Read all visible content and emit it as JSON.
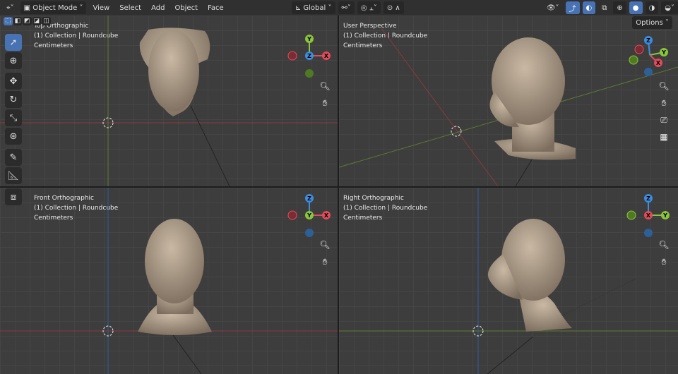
{
  "header": {
    "mode": "Object Mode",
    "menus": [
      "View",
      "Select",
      "Add",
      "Object",
      "Face"
    ],
    "orientation": "Global",
    "options": "Options"
  },
  "viewports": [
    {
      "title": "Top Orthographic",
      "collection": "(1) Collection | Roundcube",
      "units": "Centimeters"
    },
    {
      "title": "User Perspective",
      "collection": "(1) Collection | Roundcube",
      "units": "Centimeters"
    },
    {
      "title": "Front Orthographic",
      "collection": "(1) Collection | Roundcube",
      "units": "Centimeters"
    },
    {
      "title": "Right Orthographic",
      "collection": "(1) Collection | Roundcube",
      "units": "Centimeters"
    }
  ],
  "gizmo_labels": {
    "x": "X",
    "y": "Y",
    "z": "Z"
  },
  "colors": {
    "x": "#e24b5a",
    "y": "#8ac53a",
    "z": "#3d8de0",
    "accent": "#4772b3"
  }
}
